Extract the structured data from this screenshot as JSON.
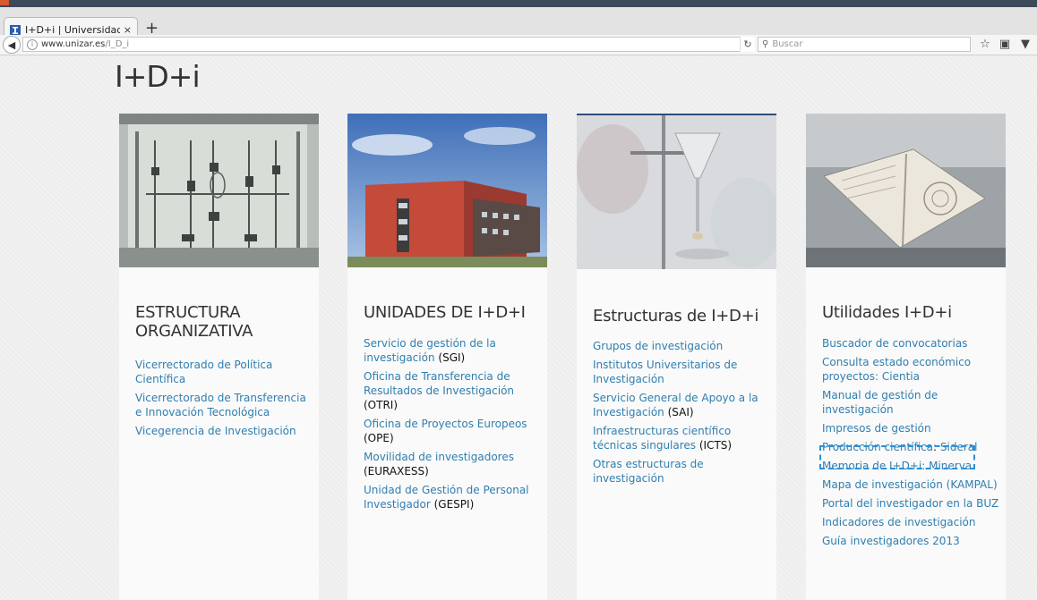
{
  "browser": {
    "tab_title": "I+D+i | Universidad de ...",
    "tab_close": "×",
    "new_tab": "+",
    "url_domain": "www.unizar.es",
    "url_path": "/I_D_i",
    "search_placeholder": "Buscar"
  },
  "page": {
    "title": "I+D+i"
  },
  "cards": [
    {
      "heading": "ESTRUCTURA ORGANIZATIVA",
      "links": [
        {
          "link": "Vicerrectorado de Política Científica"
        },
        {
          "link": "Vicerrectorado de Transferencia e Innovación Tecnológica"
        },
        {
          "link": "Vicegerencia de Investigación"
        }
      ]
    },
    {
      "heading": "UNIDADES DE I+D+I",
      "links": [
        {
          "link": "Servicio de gestión de la investigación",
          "suffix": " (SGI)"
        },
        {
          "link": "Oficina de Transferencia de Resultados de Investigación",
          "suffix": " (OTRI)"
        },
        {
          "link": "Oficina de Proyectos Europeos",
          "suffix": " (OPE)"
        },
        {
          "link": "Movilidad de investigadores",
          "suffix": " (EURAXESS)"
        },
        {
          "link": "Unidad de Gestión de Personal Investigador",
          "suffix": " (GESPI)"
        }
      ]
    },
    {
      "heading": "Estructuras de I+D+i",
      "links": [
        {
          "link": "Grupos de investigación"
        },
        {
          "link": "Institutos Universitarios de Investigación"
        },
        {
          "link": "Servicio General de Apoyo a la Investigación",
          "suffix": " (SAI)"
        },
        {
          "link": "Infraestructuras científico técnicas singulares",
          "suffix": " (ICTS)"
        },
        {
          "link": "Otras estructuras de investigación"
        }
      ]
    },
    {
      "heading": "Utilidades I+D+i",
      "links": [
        {
          "link": "Buscador de convocatorias"
        },
        {
          "link": "Consulta estado económico proyectos: Cientia"
        },
        {
          "link": "Manual de gestión de investigación"
        },
        {
          "link": "Impresos de gestión"
        },
        {
          "link": "Producción científica",
          "suffix": ": ",
          "link2": "Sideral"
        },
        {
          "link": "Memoria de I+D+i: Minerva"
        },
        {
          "link": "Mapa de investigación (KAMPAL)"
        },
        {
          "link": "Portal del investigador en la BUZ"
        },
        {
          "link": "Indicadores de investigación"
        },
        {
          "link": "Guía investigadores 2013"
        }
      ]
    }
  ]
}
